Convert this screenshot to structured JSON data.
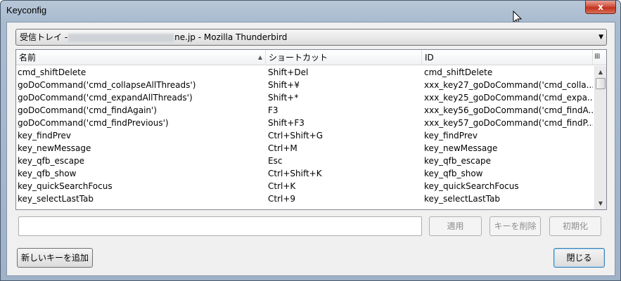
{
  "window": {
    "title": "Keyconfig",
    "close_glyph": "x"
  },
  "dropdown": {
    "value_prefix": "受信トレイ -",
    "value_suffix": "ne.jp - Mozilla Thunderbird",
    "arrow_glyph": "▼"
  },
  "table": {
    "columns": [
      "名前",
      "ショートカット",
      "ID"
    ],
    "sort_glyph": "▲",
    "picker_glyph": "⊞",
    "rows": [
      {
        "name": "cmd_shiftDelete",
        "shortcut": "Shift+Del",
        "id": "cmd_shiftDelete"
      },
      {
        "name": "goDoCommand('cmd_collapseAllThreads')",
        "shortcut": "Shift+¥",
        "id": "xxx_key27_goDoCommand('cmd_colla..."
      },
      {
        "name": "goDoCommand('cmd_expandAllThreads')",
        "shortcut": "Shift+*",
        "id": "xxx_key25_goDoCommand('cmd_expa..."
      },
      {
        "name": "goDoCommand('cmd_findAgain')",
        "shortcut": "F3",
        "id": "xxx_key56_goDoCommand('cmd_findA..."
      },
      {
        "name": "goDoCommand('cmd_findPrevious')",
        "shortcut": "Shift+F3",
        "id": "xxx_key57_goDoCommand('cmd_findP..."
      },
      {
        "name": "key_findPrev",
        "shortcut": "Ctrl+Shift+G",
        "id": "key_findPrev"
      },
      {
        "name": "key_newMessage",
        "shortcut": "Ctrl+M",
        "id": "key_newMessage"
      },
      {
        "name": "key_qfb_escape",
        "shortcut": "Esc",
        "id": "key_qfb_escape"
      },
      {
        "name": "key_qfb_show",
        "shortcut": "Ctrl+Shift+K",
        "id": "key_qfb_show"
      },
      {
        "name": "key_quickSearchFocus",
        "shortcut": "Ctrl+K",
        "id": "key_quickSearchFocus"
      },
      {
        "name": "key_selectLastTab",
        "shortcut": "Ctrl+9",
        "id": "key_selectLastTab"
      }
    ]
  },
  "scrollbar": {
    "up_glyph": "▲",
    "down_glyph": "▼"
  },
  "editor": {
    "value": "",
    "placeholder": ""
  },
  "buttons": {
    "apply": "適用",
    "delete_key": "キーを削除",
    "reset": "初期化",
    "add_key": "新しいキーを追加",
    "close": "閉じる"
  }
}
